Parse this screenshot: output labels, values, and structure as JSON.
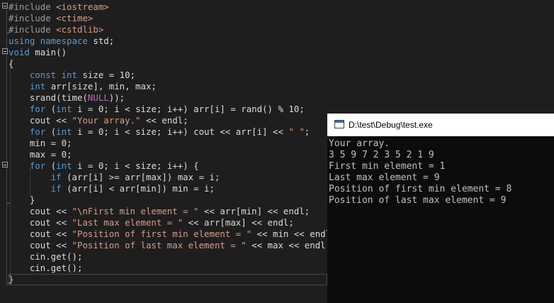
{
  "editor": {
    "lines": [
      [
        [
          "pp",
          "#include "
        ],
        [
          "inc",
          "<iostream>"
        ]
      ],
      [
        [
          "pp",
          "#include "
        ],
        [
          "inc",
          "<ctime>"
        ]
      ],
      [
        [
          "pp",
          "#include "
        ],
        [
          "inc",
          "<cstdlib>"
        ]
      ],
      [
        [
          "kw",
          "using namespace"
        ],
        [
          "tx",
          " std;"
        ]
      ],
      [
        [
          "kw",
          "void"
        ],
        [
          "tx",
          " main()"
        ]
      ],
      [
        [
          "tx",
          "{"
        ]
      ],
      [
        [
          "tx",
          "    "
        ],
        [
          "kw",
          "const int"
        ],
        [
          "tx",
          " size = 10;"
        ]
      ],
      [
        [
          "tx",
          "    "
        ],
        [
          "kw",
          "int"
        ],
        [
          "tx",
          " arr[size], min, max;"
        ]
      ],
      [
        [
          "tx",
          "    srand(time("
        ],
        [
          "mac",
          "NULL"
        ],
        [
          "tx",
          "));"
        ]
      ],
      [
        [
          "tx",
          "    "
        ],
        [
          "kw",
          "for"
        ],
        [
          "tx",
          " ("
        ],
        [
          "kw",
          "int"
        ],
        [
          "tx",
          " i = 0; i < size; i++) arr[i] = rand() % 10;"
        ]
      ],
      [
        [
          "tx",
          "    cout << "
        ],
        [
          "str",
          "\"Your array.\""
        ],
        [
          "tx",
          " << endl;"
        ]
      ],
      [
        [
          "tx",
          "    "
        ],
        [
          "kw",
          "for"
        ],
        [
          "tx",
          " ("
        ],
        [
          "kw",
          "int"
        ],
        [
          "tx",
          " i = 0; i < size; i++) cout << arr[i] << "
        ],
        [
          "str",
          "\" \""
        ],
        [
          "tx",
          ";"
        ]
      ],
      [
        [
          "tx",
          "    min = 0;"
        ]
      ],
      [
        [
          "tx",
          "    max = 0;"
        ]
      ],
      [
        [
          "tx",
          "    "
        ],
        [
          "kw",
          "for"
        ],
        [
          "tx",
          " ("
        ],
        [
          "kw",
          "int"
        ],
        [
          "tx",
          " i = 0; i < size; i++) {"
        ]
      ],
      [
        [
          "tx",
          "        "
        ],
        [
          "kw",
          "if"
        ],
        [
          "tx",
          " (arr[i] >= arr[max]) max = i;"
        ]
      ],
      [
        [
          "tx",
          "        "
        ],
        [
          "kw",
          "if"
        ],
        [
          "tx",
          " (arr[i] < arr[min]) min = i;"
        ]
      ],
      [
        [
          "tx",
          "    }"
        ]
      ],
      [
        [
          "tx",
          "    cout << "
        ],
        [
          "str",
          "\"\\nFirst min element = \""
        ],
        [
          "tx",
          " << arr[min] << endl;"
        ]
      ],
      [
        [
          "tx",
          "    cout << "
        ],
        [
          "str",
          "\"Last max element = \""
        ],
        [
          "tx",
          " << arr[max] << endl;"
        ]
      ],
      [
        [
          "tx",
          "    cout << "
        ],
        [
          "str",
          "\"Position of first min element = \""
        ],
        [
          "tx",
          " << min << endl;"
        ]
      ],
      [
        [
          "tx",
          "    cout << "
        ],
        [
          "str",
          "\"Position of last max element = \""
        ],
        [
          "tx",
          " << max << endl;"
        ]
      ],
      [
        [
          "tx",
          "    cin.get();"
        ]
      ],
      [
        [
          "tx",
          "    cin.get();"
        ]
      ],
      [
        [
          "tx",
          "}"
        ]
      ]
    ]
  },
  "console": {
    "title": "D:\\test\\Debug\\test.exe",
    "lines": [
      "Your array.",
      "3 5 9 7 2 3 5 2 1 9",
      "First min element = 1",
      "Last max element = 9",
      "Position of first min element = 8",
      "Position of last max element = 9"
    ]
  }
}
